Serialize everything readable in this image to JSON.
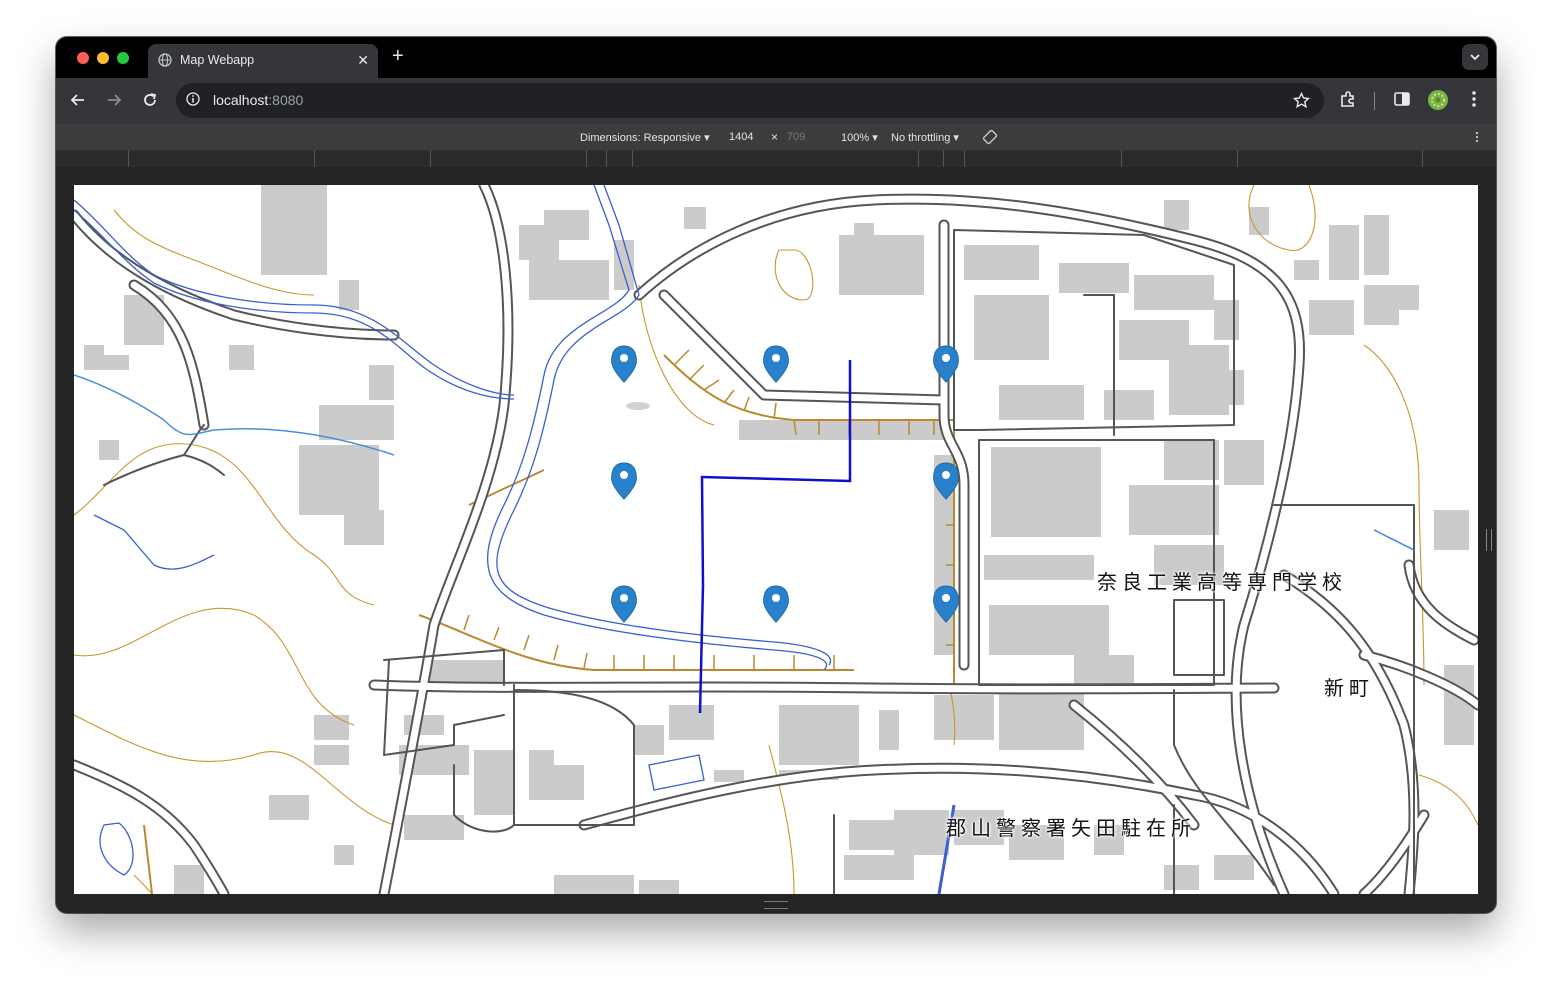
{
  "browser": {
    "tab_title": "Map Webapp",
    "url_host": "localhost",
    "url_port": ":8080",
    "new_tab": "+",
    "close_tab": "✕"
  },
  "devtools": {
    "dimensions_label": "Dimensions: Responsive",
    "width": "1404",
    "times": "×",
    "height": "709",
    "zoom": "100%",
    "throttling": "No throttling"
  },
  "map": {
    "labels": [
      "奈良工業高等専門学校",
      "新町",
      "郡山警察署矢田駐在所"
    ],
    "marker_count": 8,
    "colors": {
      "road_outline": "#555555",
      "building": "#cbcbcb",
      "contour": "#c9962e",
      "river": "#3a5fcf",
      "route": "#1010cc",
      "marker": "#2a81cb"
    }
  }
}
